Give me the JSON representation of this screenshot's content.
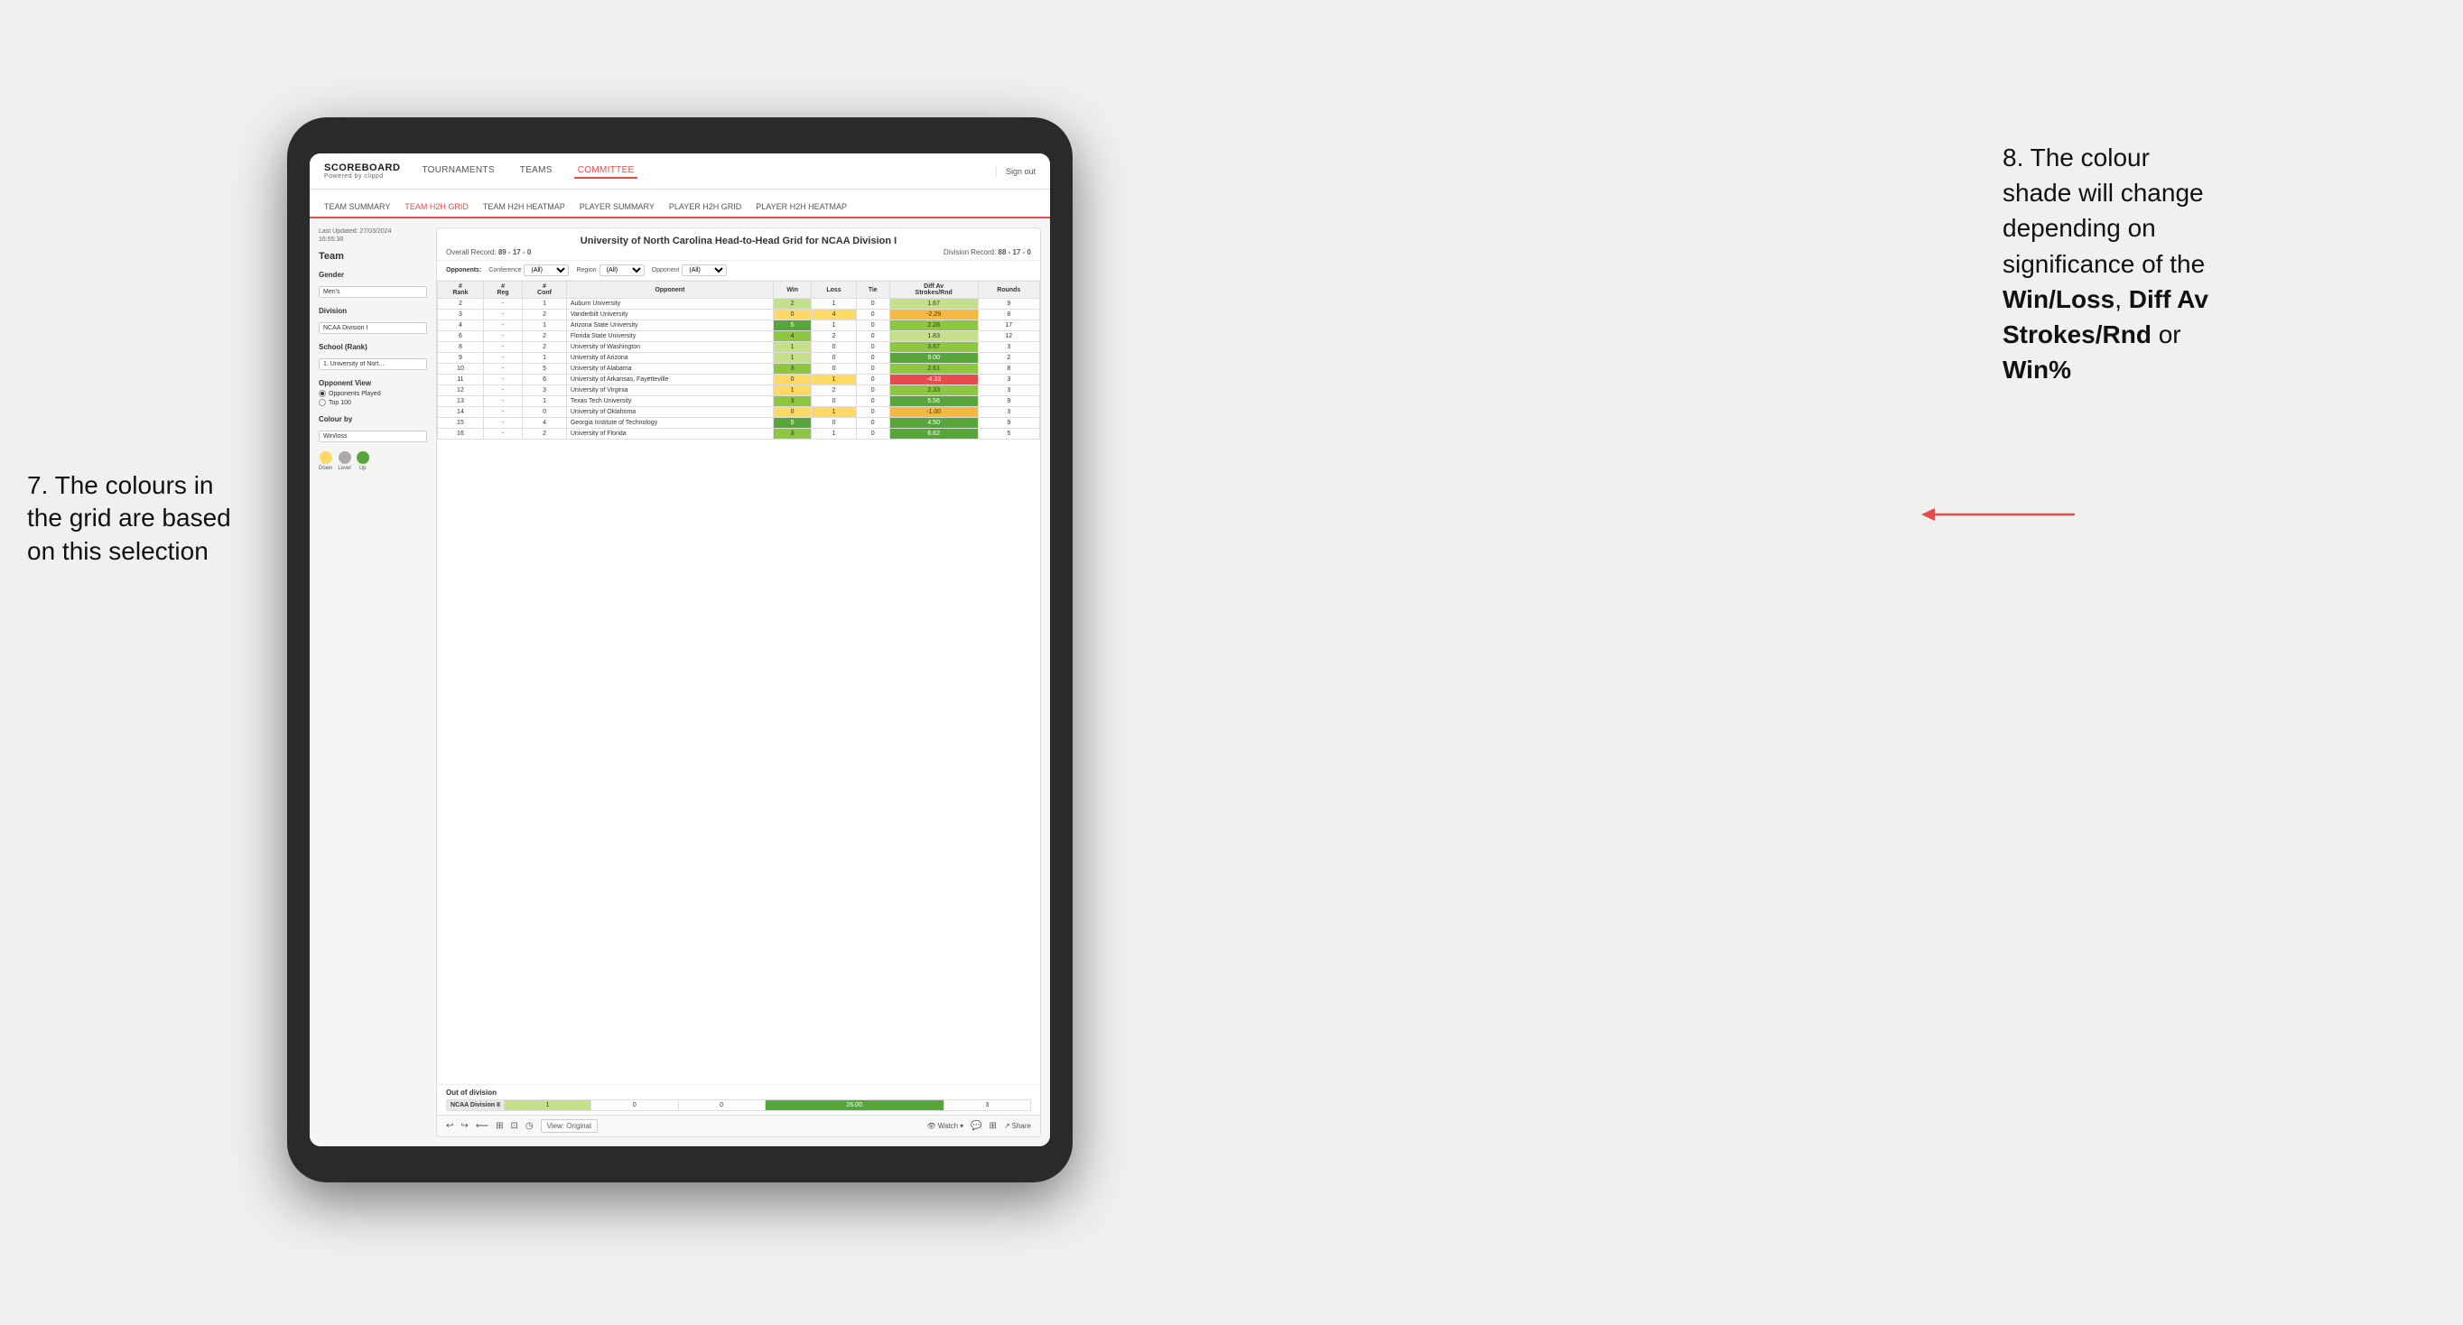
{
  "annotations": {
    "left": {
      "line1": "7. The colours in",
      "line2": "the grid are based",
      "line3": "on this selection"
    },
    "right": {
      "line1": "8. The colour",
      "line2": "shade will change",
      "line3": "depending on",
      "line4": "significance of the",
      "bold1": "Win/Loss",
      "line5": ", ",
      "bold2": "Diff Av",
      "line6": "Strokes/Rnd",
      "line7": " or",
      "bold3": "Win%"
    }
  },
  "nav": {
    "logo": "SCOREBOARD",
    "logo_sub": "Powered by clippd",
    "links": [
      "TOURNAMENTS",
      "TEAMS",
      "COMMITTEE"
    ],
    "sign_out": "Sign out"
  },
  "sub_nav": {
    "links": [
      "TEAM SUMMARY",
      "TEAM H2H GRID",
      "TEAM H2H HEATMAP",
      "PLAYER SUMMARY",
      "PLAYER H2H GRID",
      "PLAYER H2H HEATMAP"
    ]
  },
  "left_panel": {
    "last_updated_label": "Last Updated: 27/03/2024",
    "last_updated_time": "16:55:38",
    "team_label": "Team",
    "gender_label": "Gender",
    "gender_value": "Men's",
    "division_label": "Division",
    "division_value": "NCAA Division I",
    "school_label": "School (Rank)",
    "school_value": "1. University of Nort...",
    "opponent_view_label": "Opponent View",
    "radio_options": [
      "Opponents Played",
      "Top 100"
    ],
    "colour_by_label": "Colour by",
    "colour_by_value": "Win/loss",
    "legend_labels": [
      "Down",
      "Level",
      "Up"
    ]
  },
  "grid": {
    "title": "University of North Carolina Head-to-Head Grid for NCAA Division I",
    "overall_record_label": "Overall Record:",
    "overall_record": "89 - 17 - 0",
    "division_record_label": "Division Record:",
    "division_record": "88 - 17 - 0",
    "filter_opponents_label": "Opponents:",
    "filter_conference_label": "Conference",
    "filter_region_label": "Region",
    "filter_opponent_label": "Opponent",
    "filter_all": "(All)",
    "columns": [
      "#\nRank",
      "#\nReg",
      "#\nConf",
      "Opponent",
      "Win",
      "Loss",
      "Tie",
      "Diff Av\nStrokes/Rnd",
      "Rounds"
    ],
    "rows": [
      {
        "rank": "2",
        "reg": "-",
        "conf": "1",
        "opponent": "Auburn University",
        "win": "2",
        "loss": "1",
        "tie": "0",
        "diff": "1.67",
        "rounds": "9",
        "win_color": "green_light",
        "diff_color": "green_light"
      },
      {
        "rank": "3",
        "reg": "-",
        "conf": "2",
        "opponent": "Vanderbilt University",
        "win": "0",
        "loss": "4",
        "tie": "0",
        "diff": "-2.29",
        "rounds": "8",
        "win_color": "yellow",
        "diff_color": "orange"
      },
      {
        "rank": "4",
        "reg": "-",
        "conf": "1",
        "opponent": "Arizona State University",
        "win": "5",
        "loss": "1",
        "tie": "0",
        "diff": "2.28",
        "rounds": "17",
        "win_color": "green_dark",
        "diff_color": "green_mid"
      },
      {
        "rank": "6",
        "reg": "-",
        "conf": "2",
        "opponent": "Florida State University",
        "win": "4",
        "loss": "2",
        "tie": "0",
        "diff": "1.83",
        "rounds": "12",
        "win_color": "green_mid",
        "diff_color": "green_light"
      },
      {
        "rank": "8",
        "reg": "-",
        "conf": "2",
        "opponent": "University of Washington",
        "win": "1",
        "loss": "0",
        "tie": "0",
        "diff": "3.67",
        "rounds": "3",
        "win_color": "green_light",
        "diff_color": "green_mid"
      },
      {
        "rank": "9",
        "reg": "-",
        "conf": "1",
        "opponent": "University of Arizona",
        "win": "1",
        "loss": "0",
        "tie": "0",
        "diff": "9.00",
        "rounds": "2",
        "win_color": "green_light",
        "diff_color": "green_dark"
      },
      {
        "rank": "10",
        "reg": "-",
        "conf": "5",
        "opponent": "University of Alabama",
        "win": "3",
        "loss": "0",
        "tie": "0",
        "diff": "2.61",
        "rounds": "8",
        "win_color": "green_mid",
        "diff_color": "green_mid"
      },
      {
        "rank": "11",
        "reg": "-",
        "conf": "6",
        "opponent": "University of Arkansas, Fayetteville",
        "win": "0",
        "loss": "1",
        "tie": "0",
        "diff": "-4.33",
        "rounds": "3",
        "win_color": "yellow",
        "diff_color": "red"
      },
      {
        "rank": "12",
        "reg": "-",
        "conf": "3",
        "opponent": "University of Virginia",
        "win": "1",
        "loss": "2",
        "tie": "0",
        "diff": "2.33",
        "rounds": "3",
        "win_color": "yellow",
        "diff_color": "green_mid"
      },
      {
        "rank": "13",
        "reg": "-",
        "conf": "1",
        "opponent": "Texas Tech University",
        "win": "3",
        "loss": "0",
        "tie": "0",
        "diff": "5.56",
        "rounds": "9",
        "win_color": "green_mid",
        "diff_color": "green_dark"
      },
      {
        "rank": "14",
        "reg": "-",
        "conf": "0",
        "opponent": "University of Oklahoma",
        "win": "0",
        "loss": "1",
        "tie": "0",
        "diff": "-1.00",
        "rounds": "3",
        "win_color": "yellow",
        "diff_color": "orange"
      },
      {
        "rank": "15",
        "reg": "-",
        "conf": "4",
        "opponent": "Georgia Institute of Technology",
        "win": "5",
        "loss": "0",
        "tie": "0",
        "diff": "4.50",
        "rounds": "9",
        "win_color": "green_dark",
        "diff_color": "green_dark"
      },
      {
        "rank": "16",
        "reg": "-",
        "conf": "2",
        "opponent": "University of Florida",
        "win": "3",
        "loss": "1",
        "tie": "0",
        "diff": "6.62",
        "rounds": "5",
        "win_color": "green_mid",
        "diff_color": "green_dark"
      }
    ],
    "out_of_division_label": "Out of division",
    "out_of_division_rows": [
      {
        "division": "NCAA Division II",
        "win": "1",
        "loss": "0",
        "tie": "0",
        "diff": "26.00",
        "rounds": "3",
        "win_color": "green_light",
        "diff_color": "green_dark"
      }
    ]
  },
  "toolbar": {
    "view_label": "View: Original",
    "watch_label": "Watch",
    "share_label": "Share"
  }
}
